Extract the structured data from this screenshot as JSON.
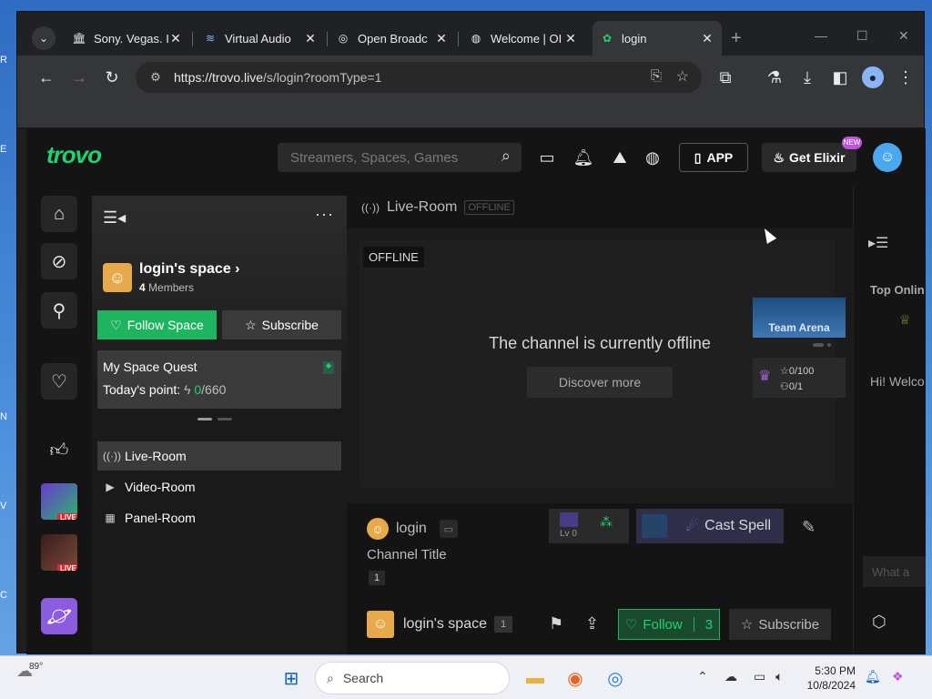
{
  "browser": {
    "tabs": [
      {
        "title": "Sony. Vegas. I",
        "favicon": "bank-icon"
      },
      {
        "title": "Virtual Audio",
        "favicon": "audio-icon"
      },
      {
        "title": "Open Broadc",
        "favicon": "obs-icon"
      },
      {
        "title": "Welcome | OI",
        "favicon": "globe-icon"
      },
      {
        "title": "login",
        "favicon": "trovo-icon"
      }
    ],
    "url_host": "https://trovo.live",
    "url_path": "/s/login?roomType=1"
  },
  "header": {
    "logo": "trovo",
    "search_placeholder": "Streamers, Spaces, Games",
    "app_label": "APP",
    "elixir_label": "Get Elixir",
    "new_badge": "NEW"
  },
  "space": {
    "name": "login's space",
    "member_count": "4",
    "members_label": "Members",
    "follow_label": "Follow Space",
    "subscribe_label": "Subscribe",
    "quest_title": "My Space Quest",
    "points_label": "Today's point:",
    "points_current": "0",
    "points_total": "/660",
    "nav": [
      {
        "label": "Live-Room",
        "icon": "broadcast-icon"
      },
      {
        "label": "Video-Room",
        "icon": "video-icon"
      },
      {
        "label": "Panel-Room",
        "icon": "panel-icon"
      }
    ]
  },
  "main": {
    "room_title": "Live-Room",
    "room_status": "OFFLINE",
    "player_label": "OFFLINE",
    "offline_message": "The channel is currently offline",
    "discover_label": "Discover more",
    "team_arena": "Team Arena",
    "stars": "0/100",
    "members": "0/1",
    "streamer": "login",
    "channel_title": "Channel Title",
    "viewers": "1",
    "level": "Lv 0",
    "cast_spell": "Cast Spell",
    "bottom_space_name": "login's space",
    "bottom_space_count": "1",
    "follow_label": "Follow",
    "follow_count": "3",
    "subscribe_label": "Subscribe"
  },
  "chat": {
    "top_online": "Top Onlin",
    "welcome": "Hi! Welco",
    "input_placeholder": "What a"
  },
  "taskbar": {
    "temperature": "89°",
    "search_label": "Search",
    "time": "5:30 PM",
    "date": "10/8/2024"
  },
  "colors": {
    "accent_green": "#1fb560",
    "live_red": "#e3262b",
    "cast_purple": "#2f2f4a"
  }
}
